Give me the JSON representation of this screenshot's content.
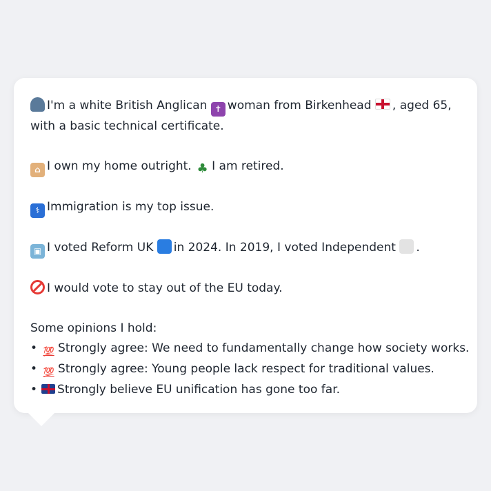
{
  "profile": {
    "line1a": "I'm a white British Anglican",
    "line1b": "woman from Birkenhead",
    "line1c": ", aged 65, with a basic technical certificate.",
    "home_a": "I own my home outright.",
    "home_b": "I am retired.",
    "issue": "Immigration is my top issue.",
    "vote_a": "I voted Reform UK",
    "vote_b": "in 2024. In 2019, I voted Independent",
    "vote_end": ".",
    "eu": "I would vote to stay out of the EU today.",
    "opinions_heading": "Some opinions I hold:",
    "opinions": [
      "Strongly agree: We need to fundamentally change how society works.",
      "Strongly agree: Young people lack respect for traditional values.",
      "Strongly believe EU unification has gone too far."
    ],
    "bullet": "•",
    "hundred": "💯"
  },
  "icons": [
    "person-icon",
    "latin-cross-icon",
    "england-flag-icon",
    "house-icon",
    "palm-tree-icon",
    "passport-control-icon",
    "ballot-box-icon",
    "blue-square-icon",
    "white-square-icon",
    "no-entry-icon",
    "hundred-points-icon",
    "uk-flag-icon"
  ]
}
